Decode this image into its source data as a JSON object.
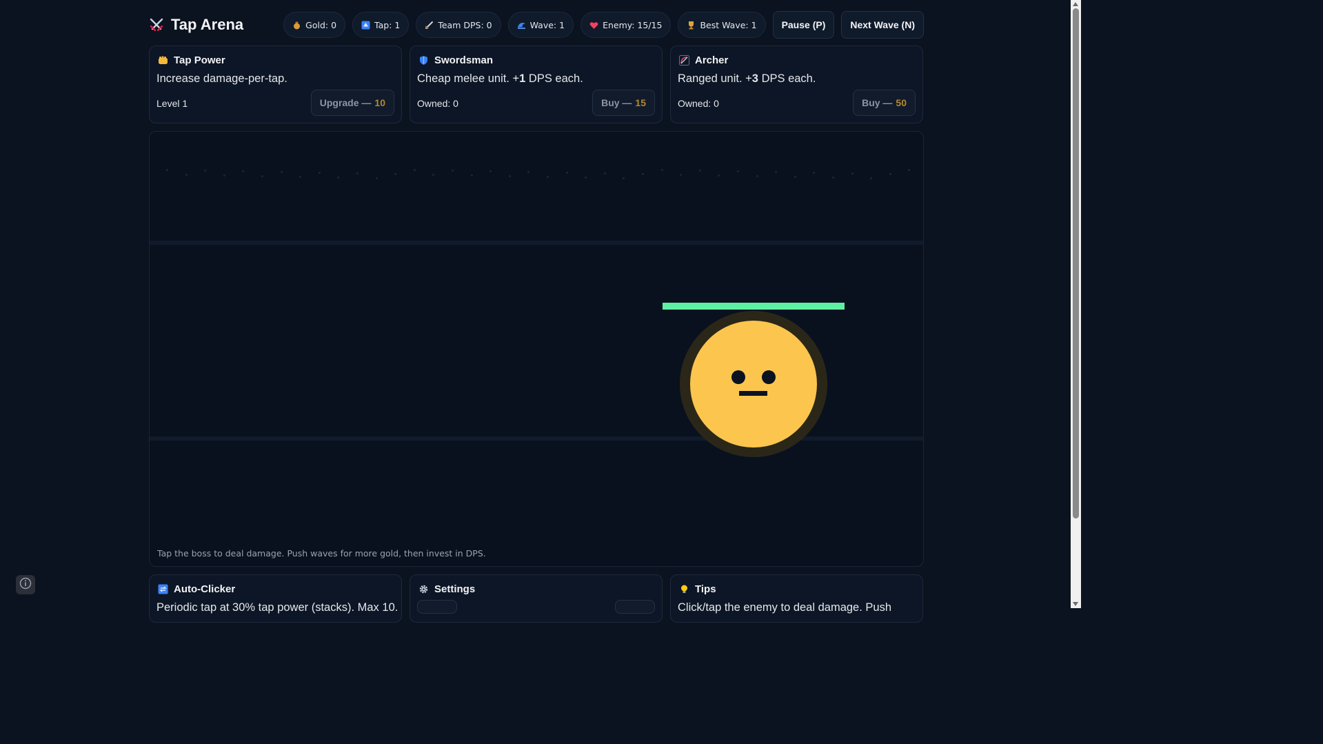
{
  "app": {
    "title": "Tap Arena",
    "icon": "crossed-swords-icon"
  },
  "stats": {
    "gold": "Gold: 0",
    "tap": "Tap: 1",
    "team_dps": "Team DPS: 0",
    "wave": "Wave: 1",
    "enemy": "Enemy: 15/15",
    "best_wave": "Best Wave: 1"
  },
  "controls": {
    "pause_label": "Pause (P)",
    "next_wave_label": "Next Wave (N)"
  },
  "shop": [
    {
      "title": "Tap Power",
      "icon": "fist-icon",
      "desc": "Increase damage-per-tap.",
      "meta": "Level 1",
      "button_label": "Upgrade —",
      "cost": "10"
    },
    {
      "title": "Swordsman",
      "icon": "shield-icon",
      "desc_prefix": "Cheap melee unit. +",
      "desc_value": "1",
      "desc_suffix": " DPS each.",
      "meta": "Owned: 0",
      "button_label": "Buy —",
      "cost": "15"
    },
    {
      "title": "Archer",
      "icon": "bow-icon",
      "desc_prefix": "Ranged unit. +",
      "desc_value": "3",
      "desc_suffix": " DPS each.",
      "meta": "Owned: 0",
      "button_label": "Buy —",
      "cost": "50"
    }
  ],
  "arena": {
    "hint": "Tap the boss to deal damage. Push waves for more gold, then invest in DPS.",
    "enemy_hp_fraction": 1.0,
    "enemy_hp_color": "#5ef0a2",
    "boss_color": "#fcc54e",
    "boss_icon": "neutral-face-icon"
  },
  "bottom_cards": [
    {
      "title": "Auto-Clicker",
      "icon": "repeat-icon",
      "desc": "Periodic tap at 30% tap power (stacks). Max 10."
    },
    {
      "title": "Settings",
      "icon": "gear-icon",
      "desc": ""
    },
    {
      "title": "Tips",
      "icon": "lightbulb-icon",
      "desc": "Click/tap the enemy to deal damage. Push"
    }
  ],
  "colors": {
    "background": "#0b1220",
    "panel": "#0d1626",
    "border": "#1e293b",
    "cost": "#b38a2e"
  }
}
